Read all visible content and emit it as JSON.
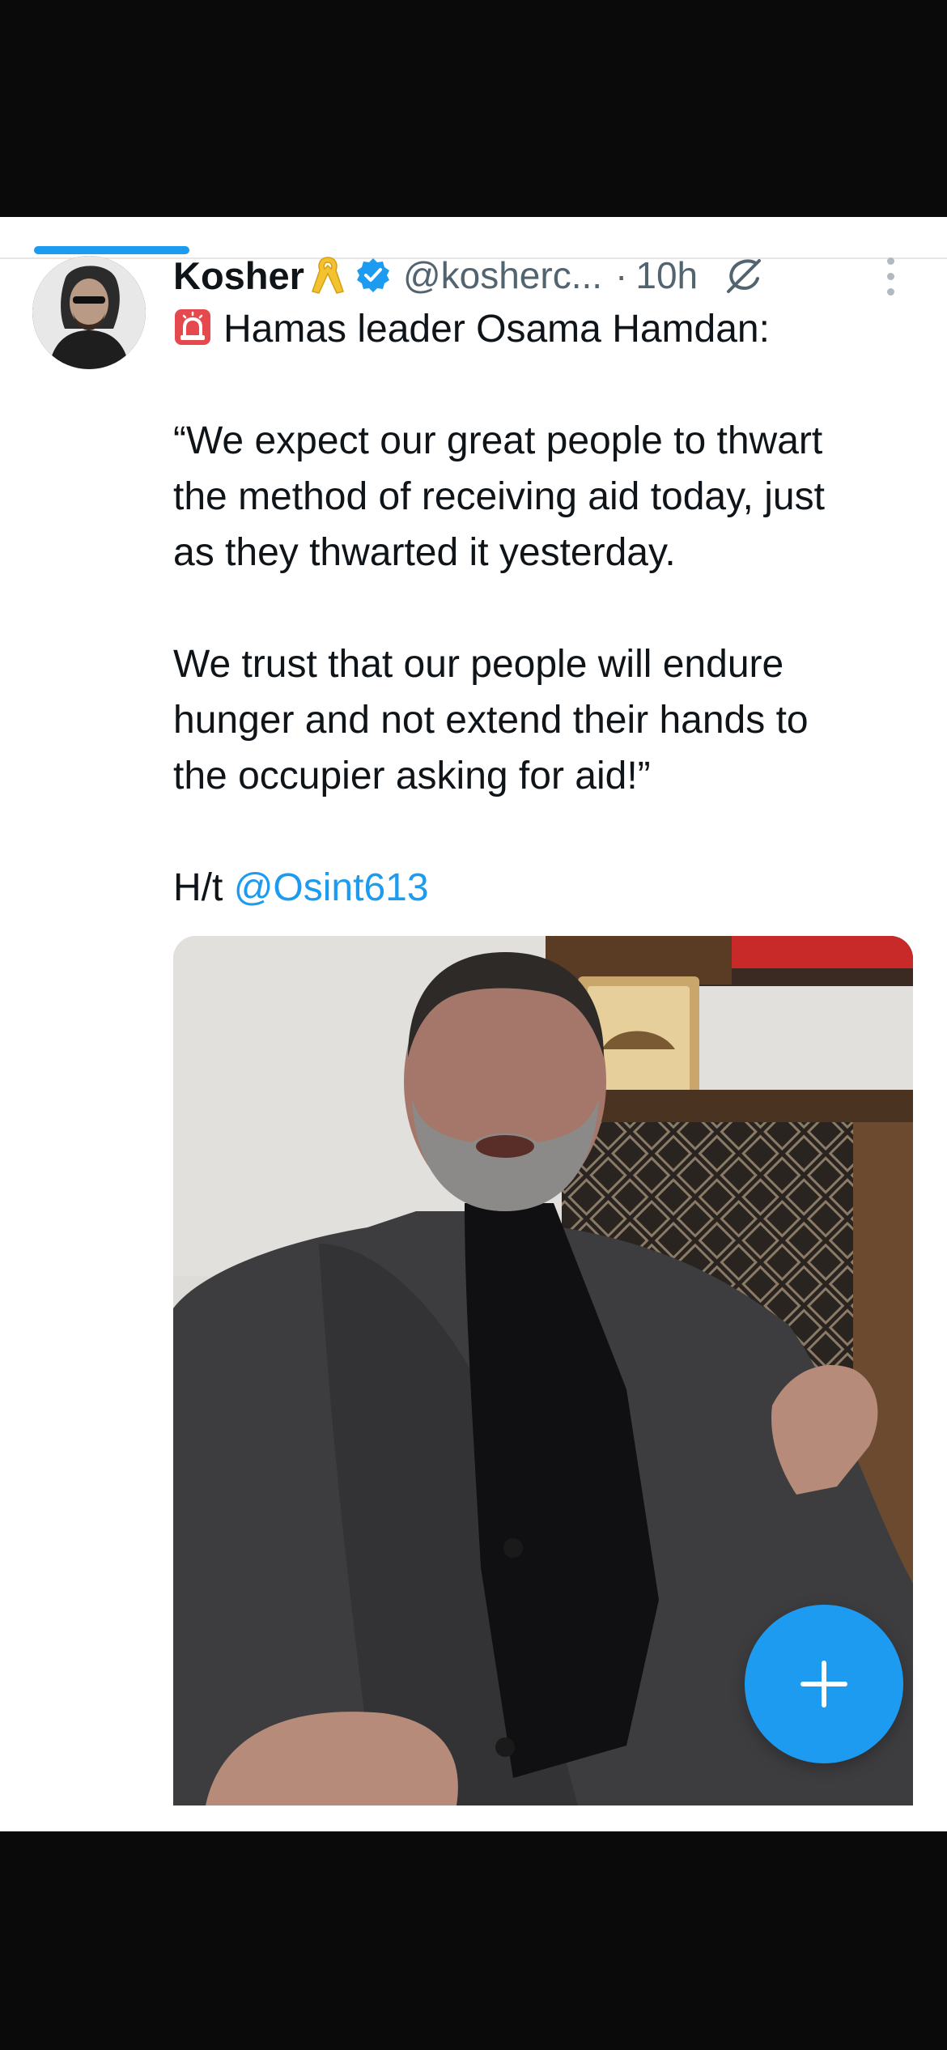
{
  "header": {
    "cut_text": "- - - - -"
  },
  "tweet": {
    "name": "Kosher",
    "handle": "@kosherc...",
    "separator": "·",
    "time": "10h",
    "lines": [
      "Hamas leader Osama Hamdan:",
      "“We expect our great people to thwart",
      "the method of receiving aid today, just",
      "as they thwarted it yesterday.",
      "We trust that our people will endure",
      "hunger and not extend their hands to",
      "the occupier asking for aid!”"
    ],
    "ht_prefix": "H/t",
    "mention": "@Osint613"
  },
  "icons": {
    "ribbon": "yellow-ribbon-icon",
    "verified": "verified-badge-icon",
    "grok": "grok-icon",
    "more": "more-options-icon",
    "siren": "siren-icon",
    "compose": "compose-plus-icon"
  },
  "colors": {
    "accent": "#1d9bf0",
    "text": "#0f1419",
    "secondary": "#536471"
  }
}
